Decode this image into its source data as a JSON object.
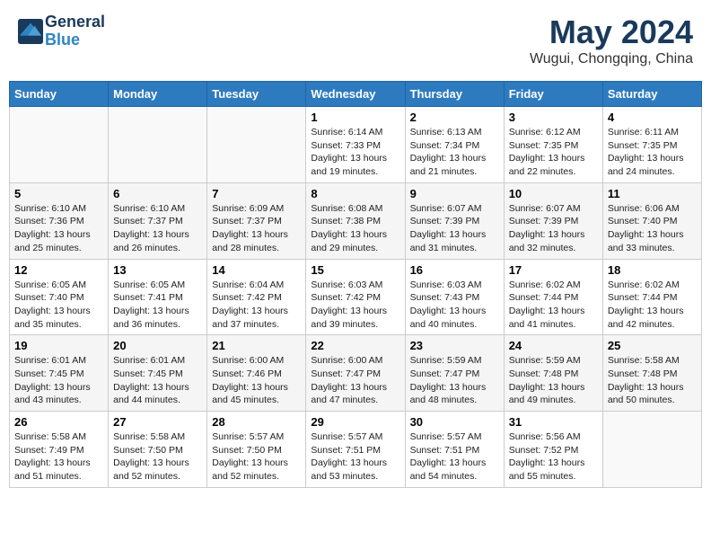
{
  "header": {
    "logo_line1": "General",
    "logo_line2": "Blue",
    "month_title": "May 2024",
    "location": "Wugui, Chongqing, China"
  },
  "days_of_week": [
    "Sunday",
    "Monday",
    "Tuesday",
    "Wednesday",
    "Thursday",
    "Friday",
    "Saturday"
  ],
  "weeks": [
    [
      {
        "day": "",
        "info": ""
      },
      {
        "day": "",
        "info": ""
      },
      {
        "day": "",
        "info": ""
      },
      {
        "day": "1",
        "info": "Sunrise: 6:14 AM\nSunset: 7:33 PM\nDaylight: 13 hours\nand 19 minutes."
      },
      {
        "day": "2",
        "info": "Sunrise: 6:13 AM\nSunset: 7:34 PM\nDaylight: 13 hours\nand 21 minutes."
      },
      {
        "day": "3",
        "info": "Sunrise: 6:12 AM\nSunset: 7:35 PM\nDaylight: 13 hours\nand 22 minutes."
      },
      {
        "day": "4",
        "info": "Sunrise: 6:11 AM\nSunset: 7:35 PM\nDaylight: 13 hours\nand 24 minutes."
      }
    ],
    [
      {
        "day": "5",
        "info": "Sunrise: 6:10 AM\nSunset: 7:36 PM\nDaylight: 13 hours\nand 25 minutes."
      },
      {
        "day": "6",
        "info": "Sunrise: 6:10 AM\nSunset: 7:37 PM\nDaylight: 13 hours\nand 26 minutes."
      },
      {
        "day": "7",
        "info": "Sunrise: 6:09 AM\nSunset: 7:37 PM\nDaylight: 13 hours\nand 28 minutes."
      },
      {
        "day": "8",
        "info": "Sunrise: 6:08 AM\nSunset: 7:38 PM\nDaylight: 13 hours\nand 29 minutes."
      },
      {
        "day": "9",
        "info": "Sunrise: 6:07 AM\nSunset: 7:39 PM\nDaylight: 13 hours\nand 31 minutes."
      },
      {
        "day": "10",
        "info": "Sunrise: 6:07 AM\nSunset: 7:39 PM\nDaylight: 13 hours\nand 32 minutes."
      },
      {
        "day": "11",
        "info": "Sunrise: 6:06 AM\nSunset: 7:40 PM\nDaylight: 13 hours\nand 33 minutes."
      }
    ],
    [
      {
        "day": "12",
        "info": "Sunrise: 6:05 AM\nSunset: 7:40 PM\nDaylight: 13 hours\nand 35 minutes."
      },
      {
        "day": "13",
        "info": "Sunrise: 6:05 AM\nSunset: 7:41 PM\nDaylight: 13 hours\nand 36 minutes."
      },
      {
        "day": "14",
        "info": "Sunrise: 6:04 AM\nSunset: 7:42 PM\nDaylight: 13 hours\nand 37 minutes."
      },
      {
        "day": "15",
        "info": "Sunrise: 6:03 AM\nSunset: 7:42 PM\nDaylight: 13 hours\nand 39 minutes."
      },
      {
        "day": "16",
        "info": "Sunrise: 6:03 AM\nSunset: 7:43 PM\nDaylight: 13 hours\nand 40 minutes."
      },
      {
        "day": "17",
        "info": "Sunrise: 6:02 AM\nSunset: 7:44 PM\nDaylight: 13 hours\nand 41 minutes."
      },
      {
        "day": "18",
        "info": "Sunrise: 6:02 AM\nSunset: 7:44 PM\nDaylight: 13 hours\nand 42 minutes."
      }
    ],
    [
      {
        "day": "19",
        "info": "Sunrise: 6:01 AM\nSunset: 7:45 PM\nDaylight: 13 hours\nand 43 minutes."
      },
      {
        "day": "20",
        "info": "Sunrise: 6:01 AM\nSunset: 7:45 PM\nDaylight: 13 hours\nand 44 minutes."
      },
      {
        "day": "21",
        "info": "Sunrise: 6:00 AM\nSunset: 7:46 PM\nDaylight: 13 hours\nand 45 minutes."
      },
      {
        "day": "22",
        "info": "Sunrise: 6:00 AM\nSunset: 7:47 PM\nDaylight: 13 hours\nand 47 minutes."
      },
      {
        "day": "23",
        "info": "Sunrise: 5:59 AM\nSunset: 7:47 PM\nDaylight: 13 hours\nand 48 minutes."
      },
      {
        "day": "24",
        "info": "Sunrise: 5:59 AM\nSunset: 7:48 PM\nDaylight: 13 hours\nand 49 minutes."
      },
      {
        "day": "25",
        "info": "Sunrise: 5:58 AM\nSunset: 7:48 PM\nDaylight: 13 hours\nand 50 minutes."
      }
    ],
    [
      {
        "day": "26",
        "info": "Sunrise: 5:58 AM\nSunset: 7:49 PM\nDaylight: 13 hours\nand 51 minutes."
      },
      {
        "day": "27",
        "info": "Sunrise: 5:58 AM\nSunset: 7:50 PM\nDaylight: 13 hours\nand 52 minutes."
      },
      {
        "day": "28",
        "info": "Sunrise: 5:57 AM\nSunset: 7:50 PM\nDaylight: 13 hours\nand 52 minutes."
      },
      {
        "day": "29",
        "info": "Sunrise: 5:57 AM\nSunset: 7:51 PM\nDaylight: 13 hours\nand 53 minutes."
      },
      {
        "day": "30",
        "info": "Sunrise: 5:57 AM\nSunset: 7:51 PM\nDaylight: 13 hours\nand 54 minutes."
      },
      {
        "day": "31",
        "info": "Sunrise: 5:56 AM\nSunset: 7:52 PM\nDaylight: 13 hours\nand 55 minutes."
      },
      {
        "day": "",
        "info": ""
      }
    ]
  ]
}
